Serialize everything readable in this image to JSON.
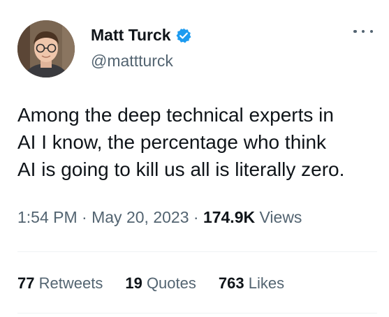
{
  "author": {
    "display_name": "Matt Turck",
    "handle": "@mattturck",
    "verified_icon": "verified-badge-icon",
    "verified_color": "#1d9bf0"
  },
  "tweet": {
    "lines": [
      "Among the deep technical experts in",
      "AI I know, the percentage who think",
      "AI is going to kill us all is literally zero."
    ]
  },
  "meta": {
    "time": "1:54 PM",
    "separator": "·",
    "date": "May 20, 2023",
    "views_count": "174.9K",
    "views_label": "Views"
  },
  "stats": {
    "retweets_count": "77",
    "retweets_label": "Retweets",
    "quotes_count": "19",
    "quotes_label": "Quotes",
    "likes_count": "763",
    "likes_label": "Likes"
  },
  "icons": {
    "more": "more-options-icon"
  },
  "colors": {
    "text_primary": "#0f1419",
    "text_secondary": "#536471",
    "divider": "#eff3f4"
  }
}
